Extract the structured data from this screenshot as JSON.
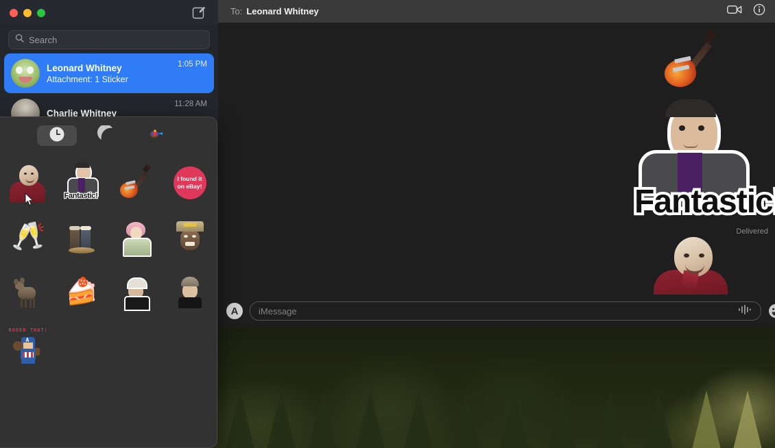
{
  "window": {
    "traffic_lights": [
      "close",
      "minimize",
      "maximize"
    ],
    "compose_icon": "compose-icon"
  },
  "sidebar": {
    "search": {
      "placeholder": "Search",
      "icon": "search-icon"
    },
    "conversations": [
      {
        "name": "Leonard Whitney",
        "snippet": "Attachment: 1 Sticker",
        "time": "1:05 PM",
        "selected": true,
        "avatar": "frog-avatar"
      },
      {
        "name": "Charlie Whitney",
        "snippet": "",
        "time": "11:28 AM",
        "selected": false,
        "avatar": "person-avatar"
      }
    ]
  },
  "conversation": {
    "to_label": "To:",
    "to_name": "Leonard Whitney",
    "facetime_icon": "video-camera-icon",
    "info_icon": "info-circle-icon",
    "messages": [
      {
        "type": "sticker",
        "name": "guitar-sticker",
        "label": ""
      },
      {
        "type": "sticker",
        "name": "fantastic-sticker",
        "label": "Fantastic!"
      },
      {
        "type": "status",
        "name": "delivery-status",
        "label": "Delivered"
      },
      {
        "type": "sticker",
        "name": "bald-man-sticker",
        "label": ""
      }
    ]
  },
  "input_bar": {
    "appstore_label": "A",
    "appstore_icon": "app-store-icon",
    "placeholder": "iMessage",
    "audio_icon": "audio-waveform-icon",
    "emoji_icon": "emoji-smiley-icon"
  },
  "sticker_picker": {
    "tabs": [
      {
        "name": "recents-tab",
        "icon": "clock-icon",
        "active": true
      },
      {
        "name": "memoji-tab",
        "icon": "crescent-moon-icon",
        "active": false
      },
      {
        "name": "stickers-tab",
        "icon": "colorful-sticker-icon",
        "active": false
      }
    ],
    "stickers": [
      {
        "name": "bald-man-red-shirt-sticker",
        "label": ""
      },
      {
        "name": "fantastic-man-sticker",
        "label": "Fantastic!"
      },
      {
        "name": "electric-guitar-sticker",
        "label": ""
      },
      {
        "name": "ebay-circle-sticker",
        "label": "I found it on eBay!"
      },
      {
        "name": "champagne-glasses-sticker",
        "label": "🥂"
      },
      {
        "name": "figurines-sticker",
        "label": ""
      },
      {
        "name": "pink-hair-woman-sticker",
        "label": ""
      },
      {
        "name": "hat-face-sticker",
        "label": ""
      },
      {
        "name": "deer-sticker",
        "label": ""
      },
      {
        "name": "cake-slice-sticker",
        "label": "🍰"
      },
      {
        "name": "cap-man-sticker",
        "label": ""
      },
      {
        "name": "beanie-man-sticker",
        "label": ""
      },
      {
        "name": "captain-america-sticker",
        "label": "ROGER THAT!"
      }
    ]
  },
  "colors": {
    "accent_blue": "#2f7cf6",
    "sidebar_bg": "#23262b",
    "pane_bg": "#1e1e1e",
    "picker_bg": "#323232",
    "header_bg": "#3a3a3a",
    "ebay_pink": "#e0385b"
  }
}
